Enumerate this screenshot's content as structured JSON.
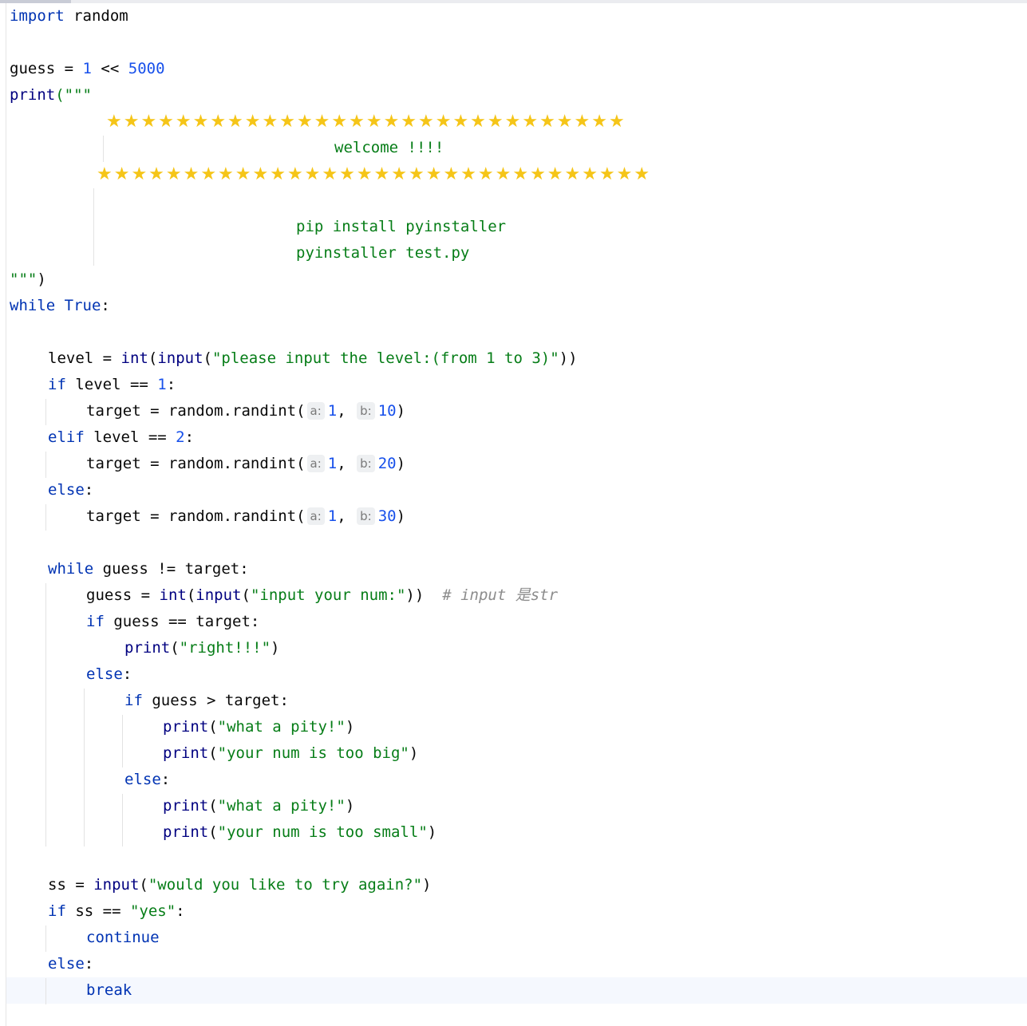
{
  "stars_row1": "★★★★★★★★★★★★★★★★★★★★★★★★★★★★★★",
  "stars_row2": "★★★★★★★★★★★★★★★★★★★★★★★★★★★★★★★★",
  "code": {
    "import_kw": "import",
    "import_mod": " random",
    "guess_var": "guess",
    "assign": " = ",
    "one": "1",
    "shift": " << ",
    "five_thousand": "5000",
    "print": "print",
    "open_triple": "(\"\"\"",
    "welcome": "welcome !!!!",
    "pip_install": "pip install pyinstaller",
    "pyinstaller_cmd": "pyinstaller test.py",
    "close_triple_quote": "\"\"\"",
    "close_paren": ")",
    "while_kw": "while",
    "true_kw": " True",
    "colon": ":",
    "level_var": "level",
    "int_fn": "int",
    "input_fn": "input",
    "level_prompt": "\"please input the level:(from 1 to 3)\"",
    "if_kw": "if",
    "level_eq": " level == ",
    "elif_kw": "elif",
    "two": "2",
    "else_kw": "else",
    "target_assign": "target = random.randint(",
    "hint_a": "a:",
    "hint_b": "b:",
    "comma": ", ",
    "ten": "10",
    "twenty": "20",
    "thirty": "30",
    "while_guess": " guess != target:",
    "guess_assign": "guess = ",
    "num_prompt": "\"input your num:\"",
    "comment": "# input 是str",
    "if_guess_eq": " guess == target:",
    "right_str": "\"right!!!\"",
    "if_guess_gt": " guess > target:",
    "pity_str": "\"what a pity!\"",
    "too_big_str": "\"your num is too big\"",
    "too_small_str": "\"your num is too small\"",
    "ss_assign": "ss = ",
    "again_prompt": "\"would you like to try again?\"",
    "ss_eq": " ss == ",
    "yes_str": "\"yes\"",
    "continue_kw": "continue",
    "break_kw": "break"
  }
}
